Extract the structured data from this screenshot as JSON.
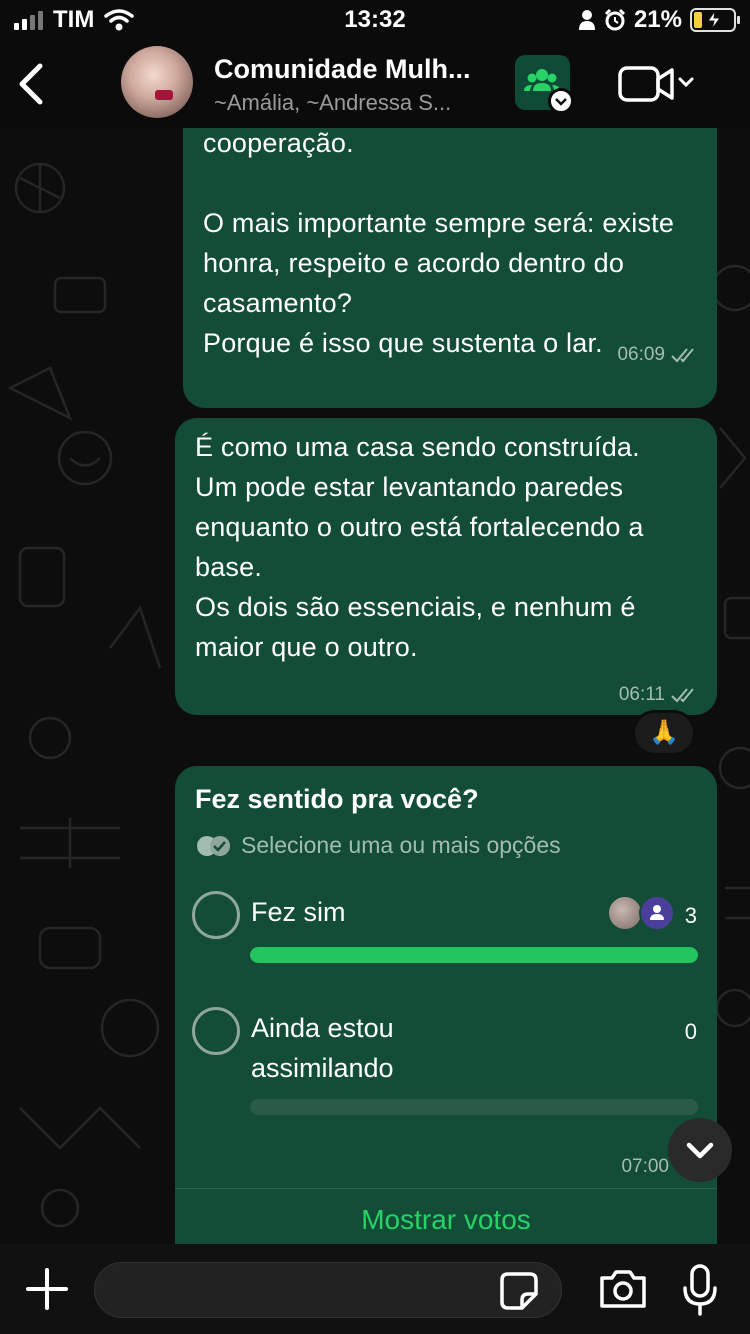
{
  "status_bar": {
    "carrier": "TIM",
    "time": "13:32",
    "battery_percent": "21%",
    "battery_level": 0.21,
    "icons": [
      "signal-icon",
      "wifi-icon",
      "person-icon",
      "alarm-icon",
      "battery-charging-icon"
    ]
  },
  "header": {
    "title": "Comunidade Mulh...",
    "subtitle": "~Amália, ~Andressa S...",
    "back_icon": "chevron-left-icon",
    "community_icon": "community-group-icon",
    "video_icon": "video-call-icon"
  },
  "messages": [
    {
      "text": "cooperação.\n\n      O mais importante sempre será: existe honra, respeito e acordo dentro do casamento?\nPorque é isso que sustenta o lar.",
      "time": "06:09",
      "status_icon": "double-check-icon"
    },
    {
      "text": "É como uma casa sendo construída.\nUm pode estar levantando paredes enquanto o outro está fortalecendo a base.\nOs dois são essenciais, e nenhum é maior que o outro.",
      "time": "06:11",
      "status_icon": "double-check-icon",
      "reaction": "🙏"
    }
  ],
  "poll": {
    "question": "Fez sentido pra você?",
    "hint": "Selecione uma ou mais opções",
    "options": [
      {
        "label": "Fez sim",
        "count": "3",
        "fraction": 1.0
      },
      {
        "label": "Ainda estou\nassimilando",
        "count": "0",
        "fraction": 0.0
      }
    ],
    "time": "07:00",
    "show_votes": "Mostrar votos"
  },
  "input_bar": {
    "placeholder": "",
    "icons": [
      "plus-icon",
      "sticker-icon",
      "camera-icon",
      "microphone-icon"
    ]
  },
  "colors": {
    "bubble": "#144d37",
    "accent_green": "#25d366",
    "poll_bar": "#22c55e",
    "background": "#0b0b0b"
  }
}
